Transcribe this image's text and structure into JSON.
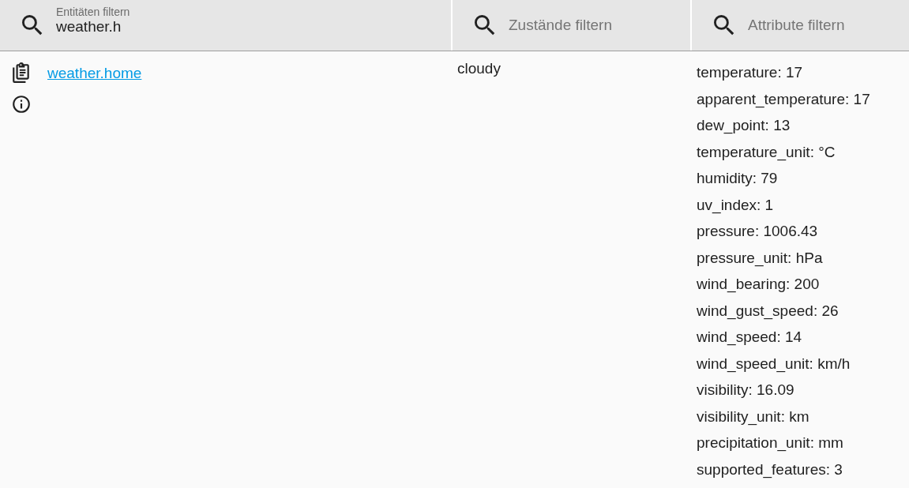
{
  "filters": [
    {
      "label": "Entitäten filtern",
      "value": "weather.h"
    },
    {
      "placeholder": "Zustände filtern"
    },
    {
      "placeholder": "Attribute filtern"
    }
  ],
  "entities": [
    {
      "entity_id": "weather.home",
      "state": "cloudy",
      "attributes": [
        "temperature: 17",
        "apparent_temperature: 17",
        "dew_point: 13",
        "temperature_unit: °C",
        "humidity: 79",
        "uv_index: 1",
        "pressure: 1006.43",
        "pressure_unit: hPa",
        "wind_bearing: 200",
        "wind_gust_speed: 26",
        "wind_speed: 14",
        "wind_speed_unit: km/h",
        "visibility: 16.09",
        "visibility_unit: km",
        "precipitation_unit: mm",
        "supported_features: 3"
      ]
    }
  ]
}
